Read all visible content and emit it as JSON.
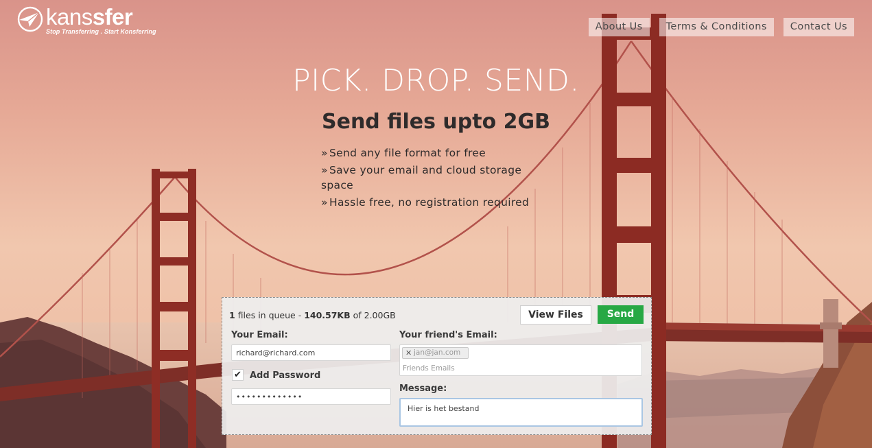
{
  "brand": {
    "name_light": "kans",
    "name_bold": "sfer",
    "tagline": "Stop Transferring . Start Konsferring"
  },
  "nav": {
    "about": "About Us",
    "terms": "Terms & Conditions",
    "contact": "Contact Us"
  },
  "hero": {
    "title": "PICK. DROP. SEND.",
    "subtitle": "Send files upto 2GB",
    "features": [
      "Send any file format for free",
      "Save your email and cloud storage space",
      "Hassle free, no registration required"
    ]
  },
  "panel": {
    "queue_count": "1",
    "queue_text": " files in queue - ",
    "queue_size": "140.57KB",
    "queue_of": " of 2.00GB",
    "view_files": "View Files",
    "send": "Send",
    "your_email_label": "Your Email:",
    "your_email_value": "richard@richard.com",
    "add_password_label": "Add Password",
    "add_password_checked": true,
    "password_value": "•••••••••••••",
    "friend_email_label": "Your friend's Email:",
    "friend_tag": "jan@jan.com",
    "friends_placeholder": "Friends Emails",
    "message_label": "Message:",
    "message_value": "Hier is het bestand"
  },
  "colors": {
    "send_button": "#27a844",
    "nav_text": "#4a4a4a",
    "message_focus_border": "#a9c6e3"
  },
  "icons": {
    "logo": "paper-plane-circle-icon",
    "check": "checkmark-icon",
    "remove_tag": "close-icon",
    "bullet": "double-chevron-right-icon"
  }
}
